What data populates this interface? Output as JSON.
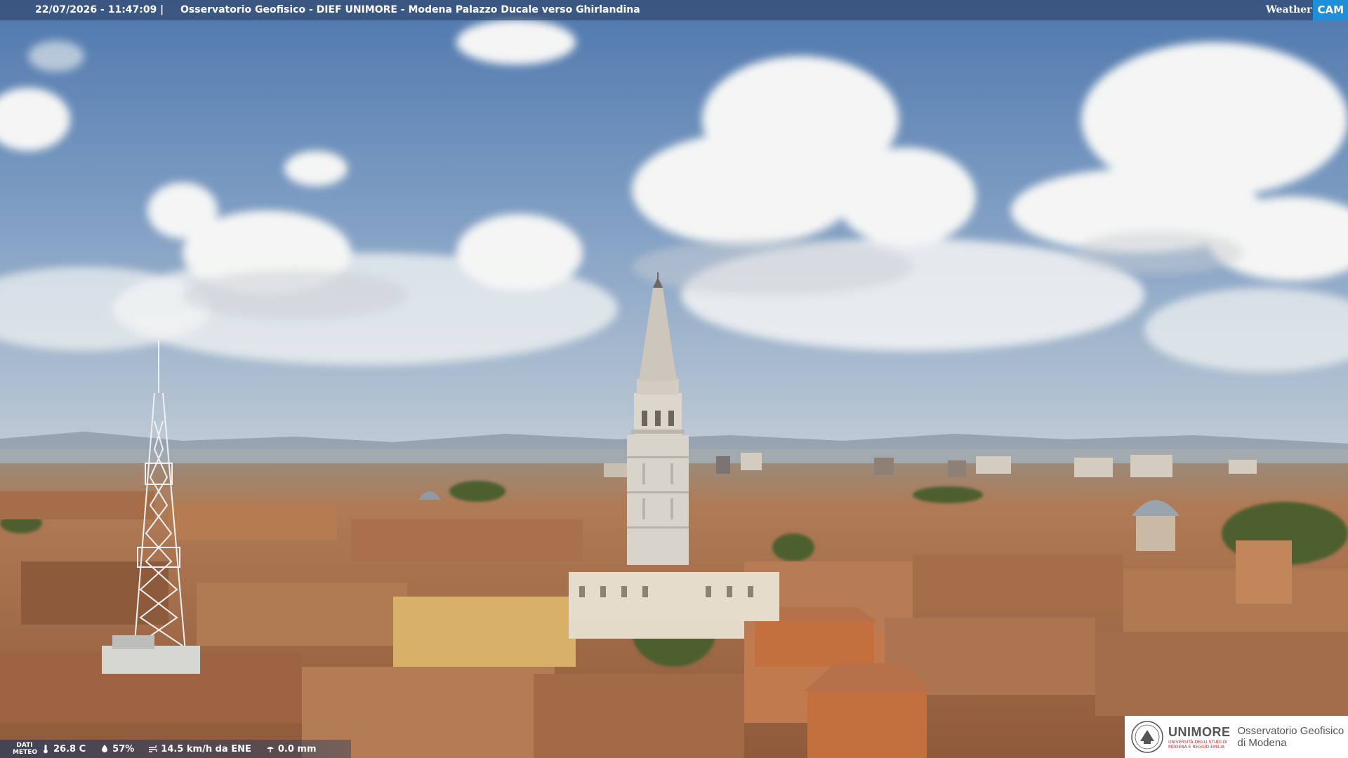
{
  "header": {
    "timestamp": "22/07/2026 - 11:47:09",
    "separator": "|",
    "title": "Osservatorio Geofisico - DIEF UNIMORE - Modena Palazzo Ducale verso Ghirlandina",
    "brand_weather": "Weather",
    "brand_cam": "CAM"
  },
  "meteo": {
    "label_line1": "DATI",
    "label_line2": "METEO",
    "temperature": "26.8 C",
    "humidity": "57%",
    "wind": "14.5 km/h da ENE",
    "rain": "0.0 mm",
    "icons": [
      "thermometer-icon",
      "humidity-drop-icon",
      "wind-icon",
      "rain-gauge-icon"
    ]
  },
  "logo": {
    "uni_main": "UNIMORE",
    "uni_sub_1": "UNIVERSITÀ DEGLI STUDI DI",
    "uni_sub_2": "MODENA E REGGIO EMILIA",
    "observatory_line1": "Osservatorio Geofisico",
    "observatory_line2": "di Modena"
  },
  "colors": {
    "sky_top": "#5d84b8",
    "sky_horizon": "#b9c6d2",
    "roof": "#b5754c",
    "tower": "#d8d3c9",
    "bar": "#2c3e5f",
    "brand_cam": "#1e8fd8",
    "unimore_red": "#c1272d"
  }
}
